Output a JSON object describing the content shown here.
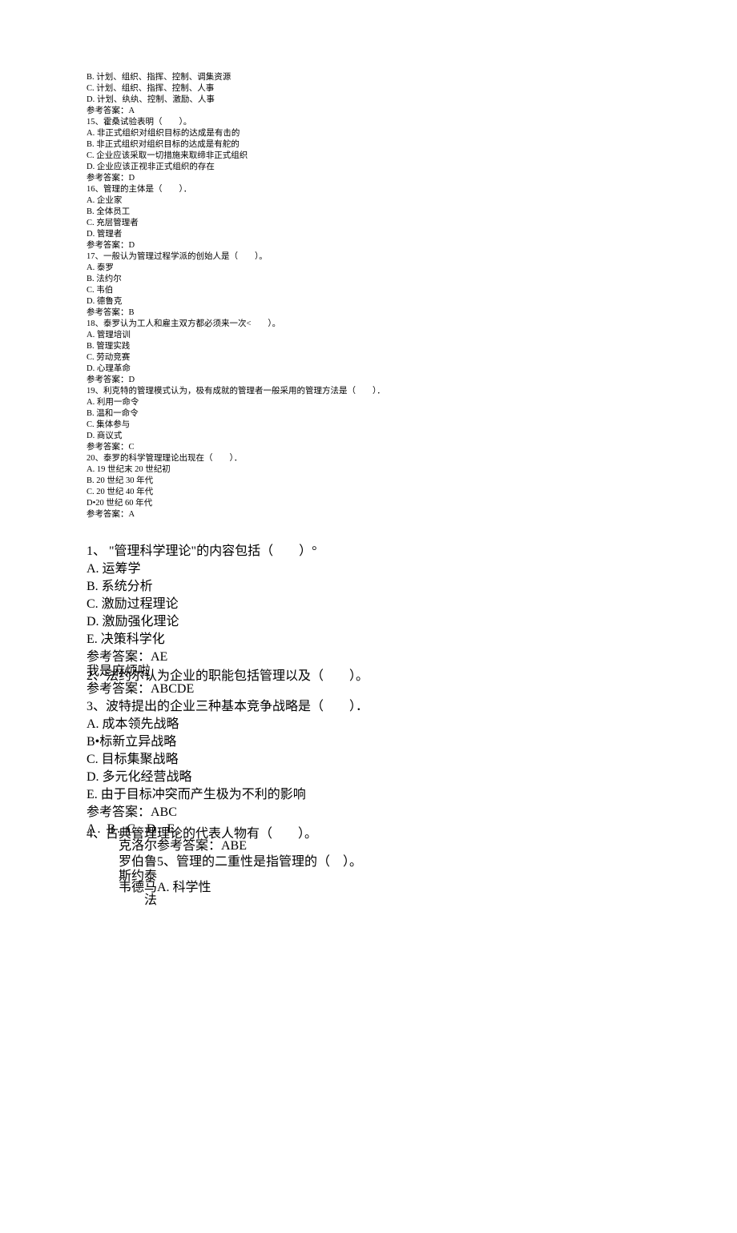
{
  "small": {
    "q14": {
      "opt_b": "B. 计划、组织、指挥、控制、调集资源",
      "opt_c": "C. 计划、组织、指挥、控制、人事",
      "opt_d": "D. 计划、纨纨、控制、激励、人事",
      "answer": "参考答案：A"
    },
    "q15": {
      "stem": "15、霍桑试验表明（　　）。",
      "opt_a": "A. 非正式组织对组织目标的达成是有击的",
      "opt_b": "B. 非正式组织对组织目标的达成是有舵的",
      "opt_c": "C. 企业应该采取一切措施来取缔非正式组织",
      "opt_d": "D. 企业应该正视非正式组织的存在",
      "answer": "参考答案：D"
    },
    "q16": {
      "stem": "16、管理的主体是（　　）．",
      "opt_a": "A. 企业家",
      "opt_b": "B. 全体员工",
      "opt_c": "C. 充层管理者",
      "opt_d": "D. 管理者",
      "answer": "参考答案：D"
    },
    "q17": {
      "stem": "17、一般认为管理过程学派的创始人是（　　）。",
      "opt_a": "A. 泰罗",
      "opt_b": "B. 法约尔",
      "opt_c": "C. 韦伯",
      "opt_d": "D. 德鲁克",
      "answer": "参考答案：B"
    },
    "q18": {
      "stem": "18、泰罗认为工人和雇主双方都必须来一次<　　）。",
      "opt_a": "A. 管理培训",
      "opt_b": "B. 管理实践",
      "opt_c": "C. 劳动竞赛",
      "opt_d": "D. 心理革命",
      "answer": "参考答案：D"
    },
    "q19": {
      "stem": "19、利克特的管理模式认为，极有成就的管理者一般采用的管理方法是（　　）．",
      "opt_a": "A. 利用一命令",
      "opt_b": "B. 温和一命令",
      "opt_c": "C. 集体参与",
      "opt_d": "D. 商议式",
      "answer": "参考答案：C"
    },
    "q20": {
      "stem": "20、泰罗的科学管理理论出现在（　　）．",
      "opt_a": "A. 19 世纪末 20 世纪初",
      "opt_b": "B. 20 世纪 30 年代",
      "opt_c": "C. 20 世纪 40 年代",
      "opt_d": "D•20 世纪 60 年代",
      "answer": "参考答案：A"
    }
  },
  "large": {
    "q1": {
      "stem": "1、 \"管理科学理论\"的内容包括（　　）°",
      "opt_a": "A. 运筹学",
      "opt_b": "B. 系统分析",
      "opt_c": "C. 激励过程理论",
      "opt_d": "D. 激励强化理论",
      "opt_e": "E. 决策科学化",
      "answer": "参考答案：AE"
    },
    "q2_line1_left": "我是麻烦啦",
    "q2_line1_right": "2、法约尔认为企业的职能包括管理以及（　　）。",
    "q2_answer": "参考答案：ABCDE",
    "q3": {
      "stem": "3、波特提出的企业三种基本竞争战略是（　　）．",
      "opt_a": "A. 成本领先战略",
      "opt_b": "B•标新立异战略",
      "opt_c": "C. 目标集聚战略",
      "opt_d": "D. 多元化经营战略",
      "opt_e": "E. 由于目标冲突而产生极为不利的影响",
      "answer": "参考答案：ABC"
    },
    "q4_stem_left": "A. B. C. D. E.",
    "q4_stem_right": "4、古典管理理论的代表人物有（　　）。",
    "ov_line2_left": "克洛尔",
    "ov_line2_right": "参考答案：ABE",
    "ov_line3_left": "罗伯鲁",
    "ov_line3_right": "5、管理的二重性是指管理的（　）。",
    "ov_line4_left": "斯约泰",
    "ov_line5_left": "韦德马",
    "ov_line5_right": "A. 科学性",
    "ov_line6": "法"
  }
}
